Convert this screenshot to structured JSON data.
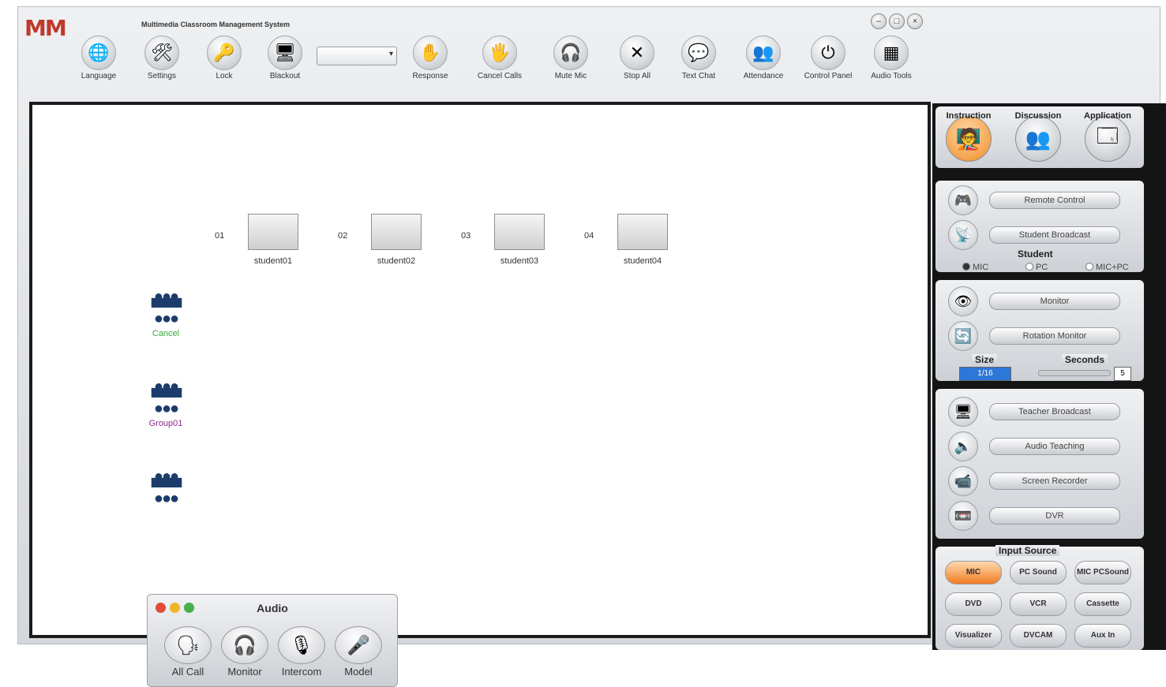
{
  "app": {
    "logo": "MM",
    "logo_suffix": "",
    "title": "Multimedia Classroom Management System",
    "window_controls": [
      "–",
      "□",
      "×"
    ]
  },
  "toolbar": {
    "items": [
      {
        "label": "Language",
        "icon": "globe-icon",
        "glyph": "🌐"
      },
      {
        "label": "Settings",
        "icon": "tools-icon",
        "glyph": "🛠"
      },
      {
        "label": "Lock",
        "icon": "key-icon",
        "glyph": "🔑"
      },
      {
        "label": "Blackout",
        "icon": "monitor-icon",
        "glyph": "🖥"
      },
      {
        "label": "Response",
        "icon": "hand-raise-icon",
        "glyph": "✋"
      },
      {
        "label": "Cancel Calls",
        "icon": "hand-icon",
        "glyph": "🖐"
      },
      {
        "label": "Mute Mic",
        "icon": "headset-icon",
        "glyph": "🎧"
      },
      {
        "label": "Stop All",
        "icon": "stop-x-icon",
        "glyph": "✕"
      },
      {
        "label": "Text Chat",
        "icon": "chat-icon",
        "glyph": "💬"
      },
      {
        "label": "Attendance",
        "icon": "people-icon",
        "glyph": "👥"
      },
      {
        "label": "Control Panel",
        "icon": "power-icon",
        "glyph": "⏻"
      },
      {
        "label": "Audio Tools",
        "icon": "audio-tools-icon",
        "glyph": "▦"
      }
    ],
    "select_value": ""
  },
  "seats": [
    {
      "num": "01",
      "name": "student01"
    },
    {
      "num": "02",
      "name": "student02"
    },
    {
      "num": "03",
      "name": "student03"
    },
    {
      "num": "04",
      "name": "student04"
    }
  ],
  "groups": [
    {
      "label": "Cancel",
      "color": "#3aa53a"
    },
    {
      "label": "Group01",
      "color": "#8a2a8a"
    },
    {
      "label": "",
      "color": "#333333"
    }
  ],
  "audio_window": {
    "title": "Audio",
    "buttons": [
      {
        "label": "All Call",
        "icon": "speaking-head-icon",
        "glyph": "🗣"
      },
      {
        "label": "Monitor",
        "icon": "headphones-icon",
        "glyph": "🎧"
      },
      {
        "label": "Intercom",
        "icon": "headset-mic-icon",
        "glyph": "🎙"
      },
      {
        "label": "Model",
        "icon": "microphone-icon",
        "glyph": "🎤"
      }
    ]
  },
  "right_panel": {
    "modes": [
      {
        "label": "Instruction",
        "icon": "teacher-icon",
        "glyph": "🧑‍🏫",
        "active": true
      },
      {
        "label": "Discussion",
        "icon": "discussion-icon",
        "glyph": "👥"
      },
      {
        "label": "Application",
        "icon": "application-icon",
        "glyph": "🗔"
      }
    ],
    "group1": [
      {
        "label": "Remote Control",
        "icon": "remote-control-icon",
        "glyph": "🎮"
      },
      {
        "label": "Student Broadcast",
        "icon": "student-broadcast-icon",
        "glyph": "📡"
      }
    ],
    "student_label": "Student",
    "student_options": [
      {
        "label": "MIC",
        "checked": true
      },
      {
        "label": "PC",
        "checked": false
      },
      {
        "label": "MIC+PC",
        "checked": false
      }
    ],
    "group2": [
      {
        "label": "Monitor",
        "icon": "monitor-eye-icon",
        "glyph": "👁"
      },
      {
        "label": "Rotation Monitor",
        "icon": "rotation-monitor-icon",
        "glyph": "🔄"
      }
    ],
    "size_label": "Size",
    "size_value": "1/16",
    "seconds_label": "Seconds",
    "seconds_value": "5",
    "group3": [
      {
        "label": "Teacher Broadcast",
        "icon": "teacher-broadcast-icon",
        "glyph": "🖥"
      },
      {
        "label": "Audio Teaching",
        "icon": "speaker-icon",
        "glyph": "🔈"
      },
      {
        "label": "Screen Recorder",
        "icon": "video-camera-icon",
        "glyph": "📹"
      },
      {
        "label": "DVR",
        "icon": "dvr-icon",
        "glyph": "📼"
      }
    ],
    "input_source_label": "Input Source",
    "input_sources": [
      {
        "label": "MIC",
        "active": true
      },
      {
        "label": "PC Sound"
      },
      {
        "label": "MIC PCSound"
      },
      {
        "label": "DVD"
      },
      {
        "label": "VCR"
      },
      {
        "label": "Cassette"
      },
      {
        "label": "Visualizer"
      },
      {
        "label": "DVCAM"
      },
      {
        "label": "Aux In"
      }
    ]
  }
}
